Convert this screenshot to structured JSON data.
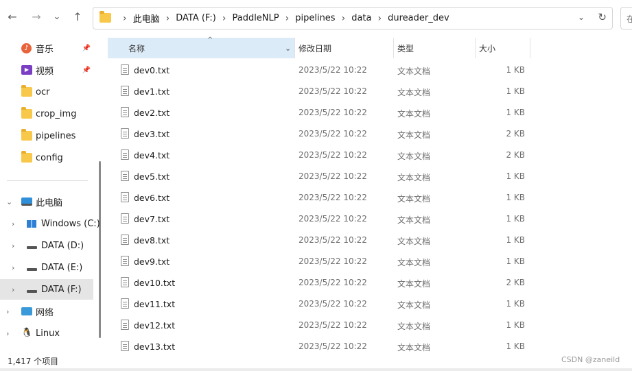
{
  "nav": {
    "back": "←",
    "forward": "→",
    "recent": "⌄",
    "up": "↑"
  },
  "address": {
    "crumbs": [
      "此电脑",
      "DATA (F:)",
      "PaddleNLP",
      "pipelines",
      "data",
      "dureader_dev"
    ],
    "dropdown": "⌄",
    "refresh": "↻"
  },
  "search": {
    "placeholder_cut": "在"
  },
  "sidebar": {
    "quick": [
      {
        "label": "音乐",
        "icon": "music-icon",
        "pinned": true
      },
      {
        "label": "视频",
        "icon": "video-icon",
        "pinned": true
      },
      {
        "label": "ocr",
        "icon": "folder-icon",
        "pinned": false
      },
      {
        "label": "crop_img",
        "icon": "folder-icon",
        "pinned": false
      },
      {
        "label": "pipelines",
        "icon": "folder-icon",
        "pinned": false
      },
      {
        "label": "config",
        "icon": "folder-icon",
        "pinned": false
      }
    ],
    "this_pc": {
      "label": "此电脑",
      "icon": "computer-icon"
    },
    "drives": [
      {
        "label": "Windows (C:)",
        "icon": "windows-drive-icon",
        "selected": false
      },
      {
        "label": "DATA (D:)",
        "icon": "drive-icon",
        "selected": false
      },
      {
        "label": "DATA (E:)",
        "icon": "drive-icon",
        "selected": false
      },
      {
        "label": "DATA (F:)",
        "icon": "drive-icon",
        "selected": true
      }
    ],
    "network": {
      "label": "网络",
      "icon": "network-icon"
    },
    "linux": {
      "label": "Linux",
      "icon": "linux-icon"
    }
  },
  "columns": {
    "name": "名称",
    "date": "修改日期",
    "type": "类型",
    "size": "大小"
  },
  "files": [
    {
      "name": "dev0.txt",
      "date": "2023/5/22 10:22",
      "type": "文本文档",
      "size": "1 KB"
    },
    {
      "name": "dev1.txt",
      "date": "2023/5/22 10:22",
      "type": "文本文档",
      "size": "1 KB"
    },
    {
      "name": "dev2.txt",
      "date": "2023/5/22 10:22",
      "type": "文本文档",
      "size": "1 KB"
    },
    {
      "name": "dev3.txt",
      "date": "2023/5/22 10:22",
      "type": "文本文档",
      "size": "2 KB"
    },
    {
      "name": "dev4.txt",
      "date": "2023/5/22 10:22",
      "type": "文本文档",
      "size": "2 KB"
    },
    {
      "name": "dev5.txt",
      "date": "2023/5/22 10:22",
      "type": "文本文档",
      "size": "1 KB"
    },
    {
      "name": "dev6.txt",
      "date": "2023/5/22 10:22",
      "type": "文本文档",
      "size": "1 KB"
    },
    {
      "name": "dev7.txt",
      "date": "2023/5/22 10:22",
      "type": "文本文档",
      "size": "1 KB"
    },
    {
      "name": "dev8.txt",
      "date": "2023/5/22 10:22",
      "type": "文本文档",
      "size": "1 KB"
    },
    {
      "name": "dev9.txt",
      "date": "2023/5/22 10:22",
      "type": "文本文档",
      "size": "1 KB"
    },
    {
      "name": "dev10.txt",
      "date": "2023/5/22 10:22",
      "type": "文本文档",
      "size": "2 KB"
    },
    {
      "name": "dev11.txt",
      "date": "2023/5/22 10:22",
      "type": "文本文档",
      "size": "1 KB"
    },
    {
      "name": "dev12.txt",
      "date": "2023/5/22 10:22",
      "type": "文本文档",
      "size": "1 KB"
    },
    {
      "name": "dev13.txt",
      "date": "2023/5/22 10:22",
      "type": "文本文档",
      "size": "1 KB"
    }
  ],
  "status": {
    "count": "1,417 个项目"
  },
  "watermark": "CSDN @zaneild",
  "colors": {
    "selected_header": "#dcebf8",
    "selected_sidebar": "#e5e5e5",
    "folder": "#f8c84a"
  }
}
